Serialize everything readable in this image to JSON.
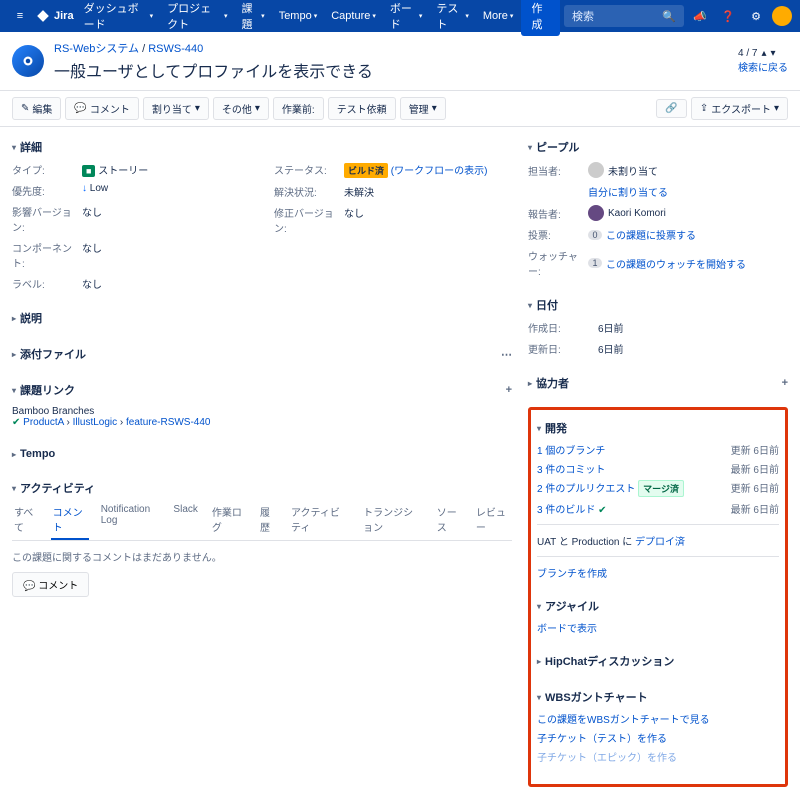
{
  "nav": {
    "product": "Jira",
    "items": [
      "ダッシュボード",
      "プロジェクト",
      "課題",
      "Tempo",
      "Capture",
      "ボード",
      "テスト",
      "More"
    ],
    "create": "作成",
    "search_placeholder": "検索"
  },
  "header": {
    "project": "RS-Webシステム",
    "key": "RSWS-440",
    "title": "一般ユーザとしてプロファイルを表示できる",
    "pager": "4 / 7",
    "back": "検索に戻る"
  },
  "toolbar": {
    "edit": "編集",
    "comment": "コメント",
    "assign": "割り当て",
    "other": "その他",
    "pre": "作業前:",
    "testreq": "テスト依頼",
    "manage": "管理",
    "export": "エクスポート"
  },
  "details": {
    "head": "詳細",
    "type_lbl": "タイプ:",
    "type_val": "ストーリー",
    "priority_lbl": "優先度:",
    "priority_val": "Low",
    "affects_lbl": "影響バージョン:",
    "affects_val": "なし",
    "components_lbl": "コンポーネント:",
    "components_val": "なし",
    "labels_lbl": "ラベル:",
    "labels_val": "なし",
    "status_lbl": "ステータス:",
    "status_badge": "ビルド済",
    "status_workflow": "(ワークフローの表示)",
    "resolution_lbl": "解決状況:",
    "resolution_val": "未解決",
    "fixv_lbl": "修正バージョン:",
    "fixv_val": "なし"
  },
  "desc_head": "説明",
  "attach_head": "添付ファイル",
  "links": {
    "head": "課題リンク",
    "bamboo": "Bamboo Branches",
    "path1": "ProductA",
    "path2": "IllustLogic",
    "path3": "feature-RSWS-440"
  },
  "tempo_head": "Tempo",
  "activity": {
    "head": "アクティビティ",
    "tabs": [
      "すべて",
      "コメント",
      "Notification Log",
      "Slack",
      "作業ログ",
      "履歴",
      "アクティビティ",
      "トランジション",
      "ソース",
      "レビュー"
    ],
    "empty": "この課題に関するコメントはまだありません。",
    "btn": "コメント"
  },
  "people": {
    "head": "ピープル",
    "assignee_lbl": "担当者:",
    "assignee_val": "未割り当て",
    "assign_me": "自分に割り当てる",
    "reporter_lbl": "報告者:",
    "reporter_val": "Kaori Komori",
    "votes_lbl": "投票:",
    "votes_count": "0",
    "votes_link": "この課題に投票する",
    "watch_lbl": "ウォッチャー:",
    "watch_count": "1",
    "watch_link": "この課題のウォッチを開始する"
  },
  "dates": {
    "head": "日付",
    "created_lbl": "作成日:",
    "created_val": "6日前",
    "updated_lbl": "更新日:",
    "updated_val": "6日前"
  },
  "collab_head": "協力者",
  "dev": {
    "head": "開発",
    "branch": "1 個のブランチ",
    "branch_upd": "更新 6日前",
    "commits": "3 件のコミット",
    "commits_upd": "最新 6日前",
    "prs": "2 件のプルリクエスト",
    "prs_badge": "マージ済",
    "prs_upd": "更新 6日前",
    "builds": "3 件のビルド",
    "builds_upd": "最新 6日前",
    "deploy1": "UAT と Production に ",
    "deploy2": "デプロイ済",
    "create_branch": "ブランチを作成"
  },
  "agile": {
    "head": "アジャイル",
    "link": "ボードで表示"
  },
  "hipchat_head": "HipChatディスカッション",
  "wbs": {
    "head": "WBSガントチャート",
    "link1": "この課題をWBSガントチャートで見る",
    "link2": "子チケット（テスト）を作る",
    "link3": "子チケット（エピック）を作る"
  }
}
